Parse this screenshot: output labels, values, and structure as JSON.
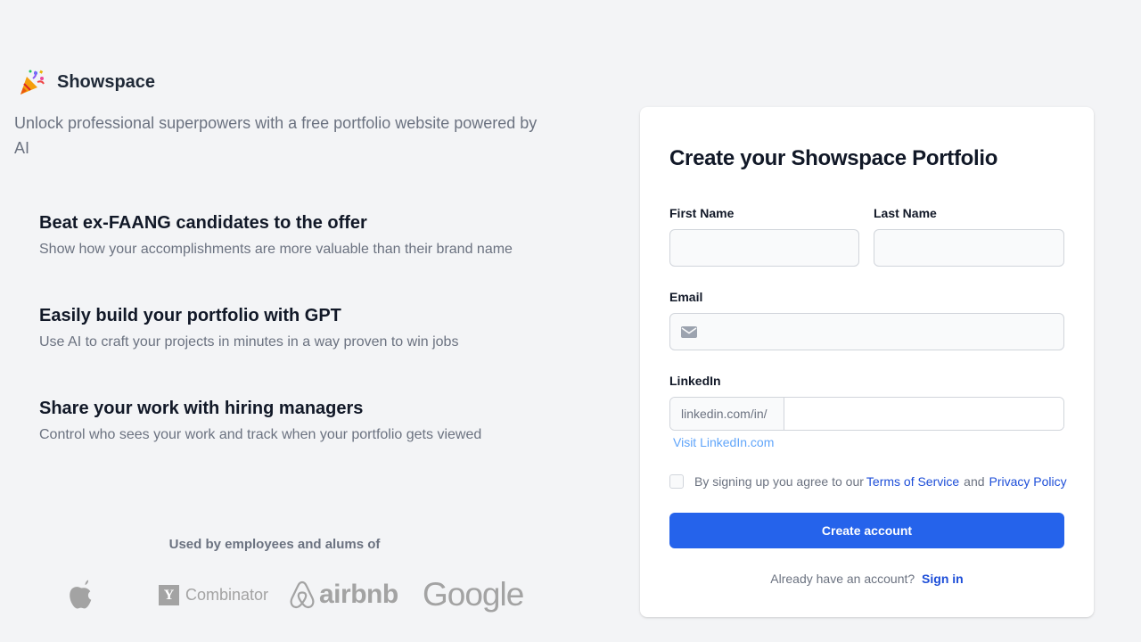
{
  "brand": {
    "icon": "party-popper-icon",
    "name": "Showspace"
  },
  "tagline": "Unlock professional superpowers with a free portfolio website powered by AI",
  "features": [
    {
      "title": "Beat ex-FAANG candidates to the offer",
      "description": "Show how your accomplishments are more valuable than their brand name"
    },
    {
      "title": "Easily build your portfolio with GPT",
      "description": "Use AI to craft your projects in minutes in a way proven to win jobs"
    },
    {
      "title": "Share your work with hiring managers",
      "description": "Control who sees your work and track when your portfolio gets viewed"
    }
  ],
  "used_by": {
    "heading": "Used by employees and alums of",
    "logos": {
      "apple": "apple-logo-icon",
      "yc_mark": "Y",
      "yc_text": "Combinator",
      "airbnb_text": "airbnb",
      "google_text": "Google"
    }
  },
  "form": {
    "title": "Create your Showspace Portfolio",
    "first_name_label": "First Name",
    "first_name_value": "",
    "last_name_label": "Last Name",
    "last_name_value": "",
    "email_label": "Email",
    "email_value": "",
    "email_icon": "mail-icon",
    "linkedin_label": "LinkedIn",
    "linkedin_prefix": "linkedin.com/in/",
    "linkedin_value": "",
    "visit_link": "Visit LinkedIn.com",
    "terms_prefix": "By signing up you agree to our",
    "terms_link": "Terms of Service",
    "terms_and": "and",
    "privacy_link": "Privacy Policy",
    "terms_checked": false,
    "submit_label": "Create account",
    "signin_prompt": "Already have an account?",
    "signin_link": "Sign in"
  },
  "colors": {
    "background": "#f3f4f6",
    "primary": "#2563eb",
    "link": "#1d4ed8",
    "muted_link": "#60a5fa",
    "logo_gray": "#a3a3a3"
  }
}
